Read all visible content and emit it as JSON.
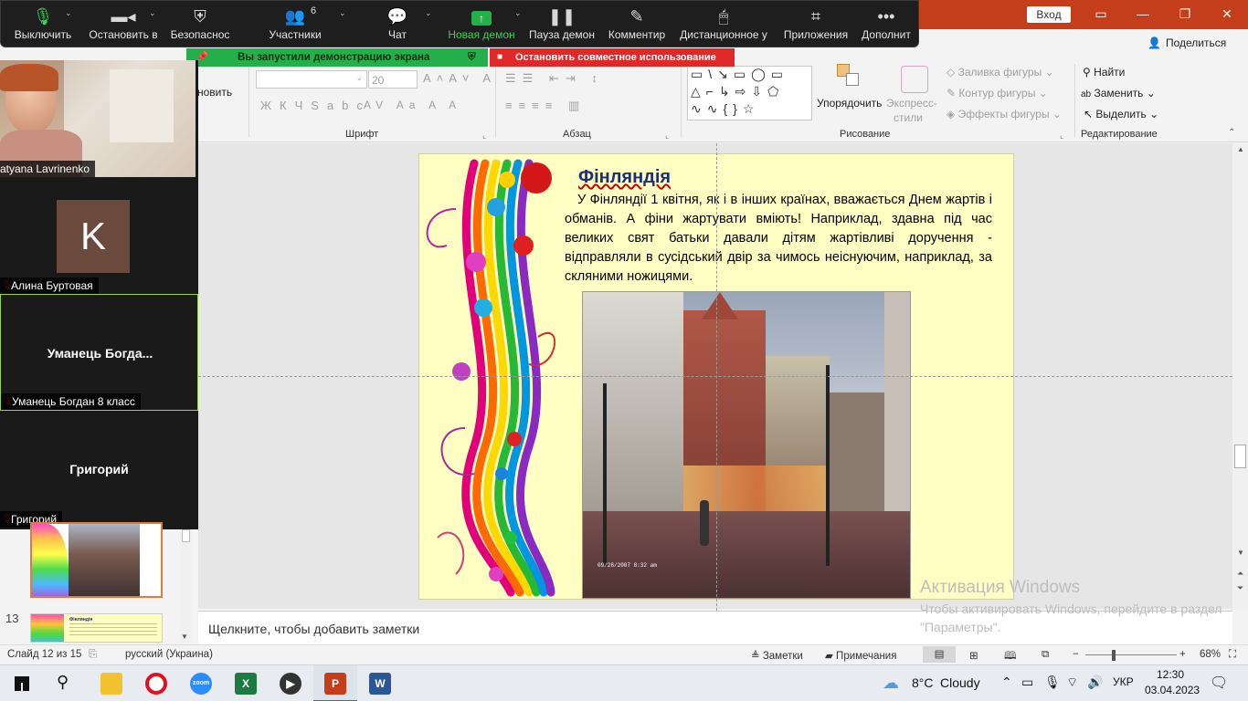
{
  "powerpoint": {
    "sign_in": "Вход",
    "share": "Поделиться",
    "ribbon": {
      "fragment_format": "новить",
      "font_size": "20",
      "font_group": "Шрифт",
      "paragraph_group": "Абзац",
      "drawing_group": "Рисование",
      "editing_group": "Редактирование",
      "arrange": "Упорядочить",
      "quick_styles": [
        "Экспресс-",
        "стили"
      ],
      "shape_fill": "Заливка фигуры",
      "shape_outline": "Контур фигуры",
      "shape_effects": "Эффекты фигуры",
      "find": "Найти",
      "replace": "Заменить",
      "select": "Выделить"
    },
    "slide": {
      "title": "Фінляндія",
      "body": "У Фінляндії 1 квітня, як і в інших країнах, вважається Днем жартів і обманів. А фіни жартувати вміють! Наприклад, здавна під час великих свят батьки давали дітям жартівливі доручення - відправляли в сусідський двір за чимось неіснуючим, наприклад, за скляними ножицями.",
      "photo_timestamp": "09/28/2007 8:32 am"
    },
    "thumbnails": {
      "next_number": "13",
      "next_title": "Фінляндія"
    },
    "notes_placeholder": "Щелкните, чтобы добавить заметки",
    "status": {
      "slide_counter": "Слайд 12 из 15",
      "language": "русский (Украина)",
      "notes": "Заметки",
      "comments": "Примечания",
      "zoom": "68%"
    }
  },
  "zoom": {
    "toolbar": {
      "mute": "Выключить",
      "video": "Остановить в",
      "security": "Безопаснос",
      "participants": "Участники",
      "participants_count": "6",
      "chat": "Чат",
      "new_share": "Новая демон",
      "pause_share": "Пауза демон",
      "annotate": "Комментир",
      "remote_control": "Дистанционное у",
      "apps": "Приложения",
      "more": "Дополнит"
    },
    "share_banner": "Вы запустили демонстрацию экрана",
    "stop_share": "Остановить совместное использование",
    "participants": [
      {
        "name": "atyana Lavrinenko"
      },
      {
        "name": "Алина Буртовая",
        "initial": "K"
      },
      {
        "name": "Уманець Богдан 8 класс",
        "display": "Уманець  Богда..."
      },
      {
        "name": "Григорий",
        "display": "Григорий"
      }
    ]
  },
  "activation": {
    "title": "Активация Windows",
    "subtitle": "Чтобы активировать Windows, перейдите в раздел \"Параметры\"."
  },
  "taskbar": {
    "weather_temp": "8°C",
    "weather_text": "Cloudy",
    "language": "УКР",
    "time": "12:30",
    "date": "03.04.2023",
    "apps": [
      "windows-start",
      "search",
      "file-explorer",
      "opera",
      "zoom",
      "excel",
      "media-player",
      "powerpoint",
      "word"
    ]
  },
  "colors": {
    "ppt_accent": "#c43e1c",
    "zoom_green": "#23b04a",
    "zoom_red": "#e02828",
    "slide_bg": "#ffffc4"
  }
}
